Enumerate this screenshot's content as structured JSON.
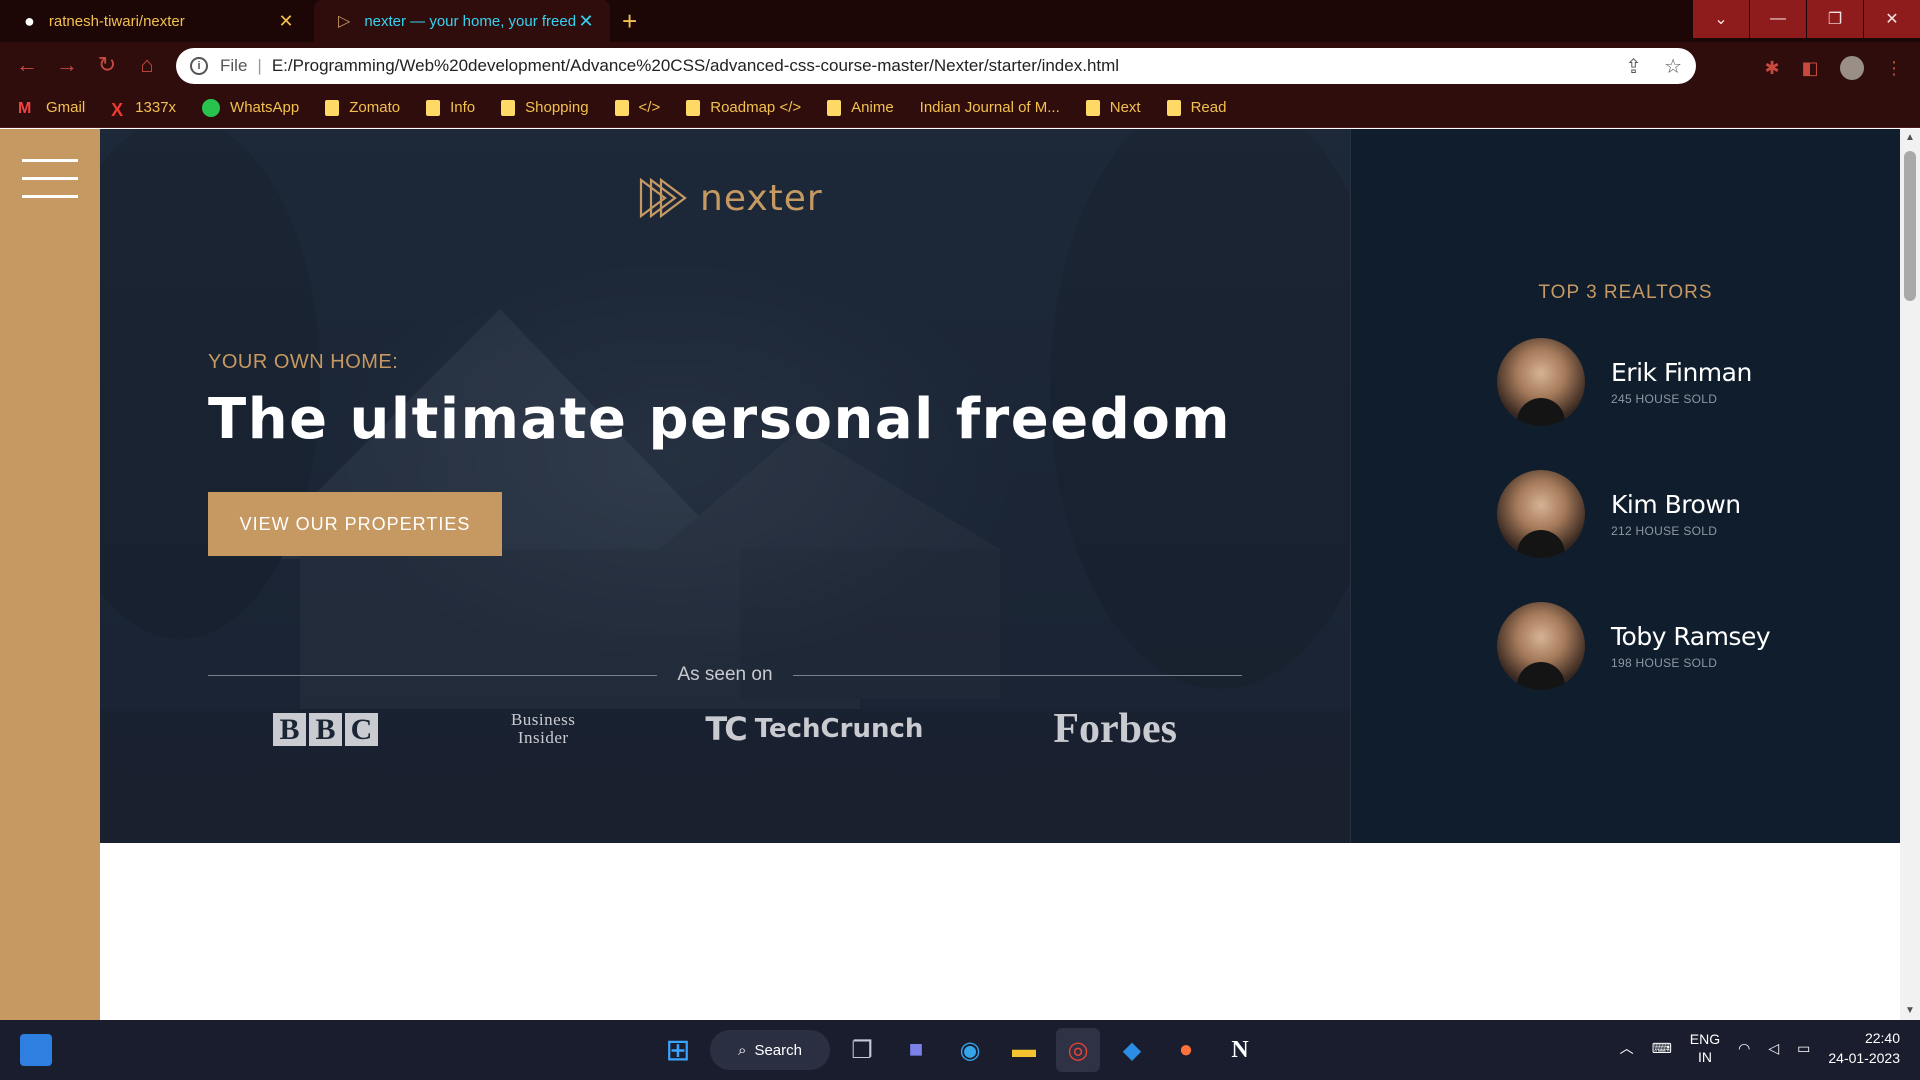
{
  "browser": {
    "tabs": [
      {
        "title": "ratnesh-tiwari/nexter",
        "icon": "github-icon",
        "active": false
      },
      {
        "title": "nexter — your home, your freedom",
        "icon": "nexter-logo-icon",
        "active": true
      }
    ],
    "new_tab_label": "+",
    "window_controls": {
      "tab_search": "⌄",
      "minimize": "—",
      "restore": "❐",
      "close": "✕"
    },
    "nav": {
      "back": "←",
      "forward": "→",
      "reload": "↻",
      "home": "⌂"
    },
    "address_bar": {
      "scheme_label": "File",
      "url": "E:/Programming/Web%20development/Advance%20CSS/advanced-css-course-master/Nexter/starter/index.html",
      "share_icon": "⇪",
      "star_icon": "☆"
    },
    "extensions_icon": "✱",
    "sidepanel_icon": "◧",
    "menu_icon": "⋮",
    "bookmarks": [
      {
        "label": "Gmail",
        "icon": "gmail"
      },
      {
        "label": "1337x",
        "icon": "x"
      },
      {
        "label": "WhatsApp",
        "icon": "wa"
      },
      {
        "label": "Zomato",
        "icon": "folder"
      },
      {
        "label": "Info",
        "icon": "folder"
      },
      {
        "label": "Shopping",
        "icon": "folder"
      },
      {
        "label": "</>",
        "icon": "folder"
      },
      {
        "label": "Roadmap </>",
        "icon": "folder"
      },
      {
        "label": "Anime",
        "icon": "folder"
      },
      {
        "label": "Indian Journal of M...",
        "icon": "none"
      },
      {
        "label": "Next",
        "icon": "folder"
      },
      {
        "label": "Read",
        "icon": "folder"
      }
    ]
  },
  "page": {
    "logo_text": "nexter",
    "eyebrow": "YOUR OWN HOME:",
    "headline": "The ultimate personal freedom",
    "cta_label": "VIEW OUR PROPERTIES",
    "seen_on_label": "As seen on",
    "brands": {
      "bbc": [
        "B",
        "B",
        "C"
      ],
      "business_insider": [
        "Business",
        "Insider"
      ],
      "techcrunch": "TechCrunch",
      "forbes": "Forbes"
    },
    "realtors_title": "TOP 3 REALTORS",
    "realtors": [
      {
        "name": "Erik Finman",
        "sold": "245 HOUSE SOLD"
      },
      {
        "name": "Kim Brown",
        "sold": "212 HOUSE SOLD"
      },
      {
        "name": "Toby Ramsey",
        "sold": "198 HOUSE SOLD"
      }
    ]
  },
  "taskbar": {
    "search_label": "Search",
    "language": [
      "ENG",
      "IN"
    ],
    "time": "22:40",
    "date": "24-01-2023"
  },
  "colors": {
    "primary": "#c69963",
    "dark_bg": "#101d2c",
    "tab_accent": "#35d3f0",
    "chrome_text": "#f2c14e"
  }
}
